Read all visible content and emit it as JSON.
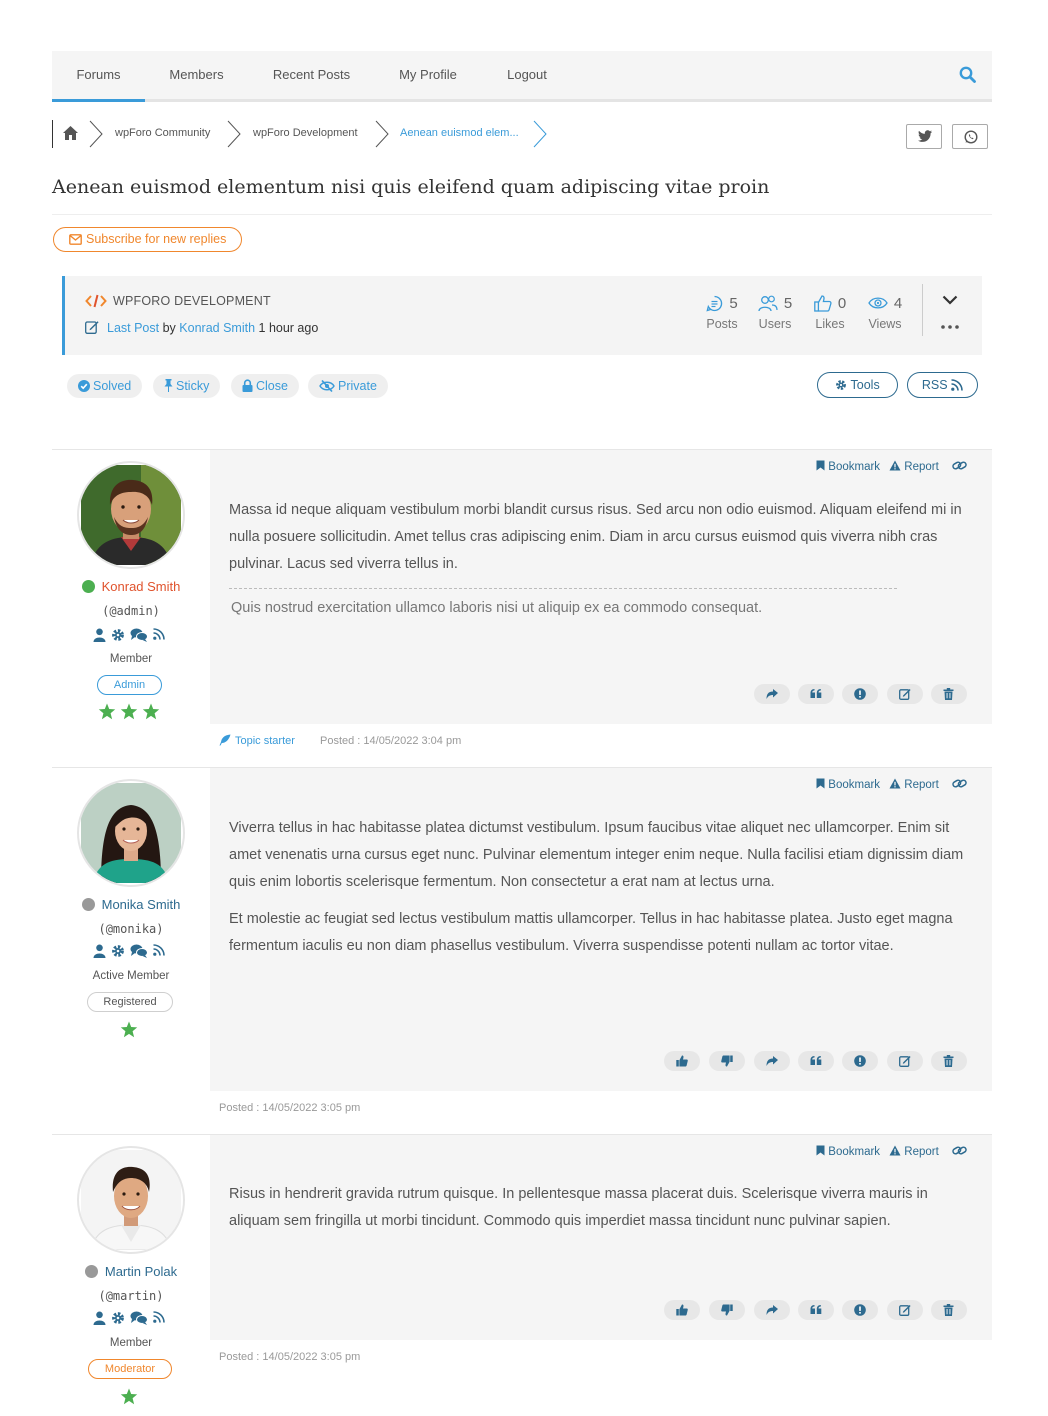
{
  "nav": {
    "items": [
      "Forums",
      "Members",
      "Recent Posts",
      "My Profile",
      "Logout"
    ],
    "search_icon": "search-icon",
    "accent_color": "#3a9bd9"
  },
  "breadcrumb": {
    "home_icon": "home-icon",
    "items": [
      "wpForo Community",
      "wpForo Development",
      "Aenean euismod elem..."
    ]
  },
  "share": {
    "twitter_icon": "twitter-icon",
    "whatsapp_icon": "whatsapp-icon"
  },
  "topic": {
    "title": "Aenean euismod elementum nisi quis eleifend quam adipiscing vitae proin",
    "subscribe_label": "Subscribe for new replies"
  },
  "panel": {
    "category": "WPFORO DEVELOPMENT",
    "last_post_label": "Last Post",
    "by": "by",
    "last_post_author": "Konrad Smith",
    "last_post_time": "1 hour ago",
    "stats": [
      {
        "value": "5",
        "label": "Posts",
        "icon": "posts-icon"
      },
      {
        "value": "5",
        "label": "Users",
        "icon": "users-icon"
      },
      {
        "value": "0",
        "label": "Likes",
        "icon": "likes-icon"
      },
      {
        "value": "4",
        "label": "Views",
        "icon": "views-icon"
      }
    ]
  },
  "tags": [
    "Solved",
    "Sticky",
    "Close",
    "Private"
  ],
  "tools": {
    "tools_label": "Tools",
    "rss_label": "RSS"
  },
  "post_actions": {
    "bookmark": "Bookmark",
    "report": "Report"
  },
  "posts": [
    {
      "author": "Konrad Smith",
      "handle": "(@admin)",
      "online": true,
      "title": "Member",
      "badge": "Admin",
      "stars": 3,
      "body": [
        "Massa id neque aliquam vestibulum morbi blandit cursus risus. Sed arcu non odio euismod. Aliquam eleifend mi in nulla posuere sollicitudin. Amet tellus cras adipiscing enim. Diam in arcu cursus euismod quis viverra nibh cras pulvinar. Lacus sed viverra tellus in."
      ],
      "signature": "Quis nostrud exercitation ullamco laboris nisi ut aliquip ex ea commodo consequat.",
      "starter_label": "Topic starter",
      "posted": "Posted : 14/05/2022 3:04 pm"
    },
    {
      "author": "Monika Smith",
      "handle": "(@monika)",
      "online": false,
      "title": "Active Member",
      "badge": "Registered",
      "stars": 1,
      "body": [
        "Viverra tellus in hac habitasse platea dictumst vestibulum. Ipsum faucibus vitae aliquet nec ullamcorper. Enim sit amet venenatis urna cursus eget nunc. Pulvinar elementum integer enim neque. Nulla facilisi etiam dignissim diam quis enim lobortis scelerisque fermentum. Non consectetur a erat nam at lectus urna.",
        "Et molestie ac feugiat sed lectus vestibulum mattis ullamcorper. Tellus in hac habitasse platea. Justo eget magna fermentum iaculis eu non diam phasellus vestibulum. Viverra suspendisse potenti nullam ac tortor vitae."
      ],
      "posted": "Posted : 14/05/2022 3:05 pm"
    },
    {
      "author": "Martin Polak",
      "handle": "(@martin)",
      "online": false,
      "title": "Member",
      "badge": "Moderator",
      "stars": 1,
      "body": [
        "Risus in hendrerit gravida rutrum quisque. In pellentesque massa placerat duis. Scelerisque viverra mauris in aliquam sem fringilla ut morbi tincidunt. Commodo quis imperdiet massa tincidunt nunc pulvinar sapien."
      ],
      "posted": "Posted : 14/05/2022 3:05 pm"
    }
  ],
  "colors": {
    "online": "#4caf50",
    "offline": "#999999",
    "admin_badge": "#3a9bd9",
    "moderator_badge": "#f0872d",
    "star": "#4caf50",
    "subscribe": "#f0872d"
  }
}
